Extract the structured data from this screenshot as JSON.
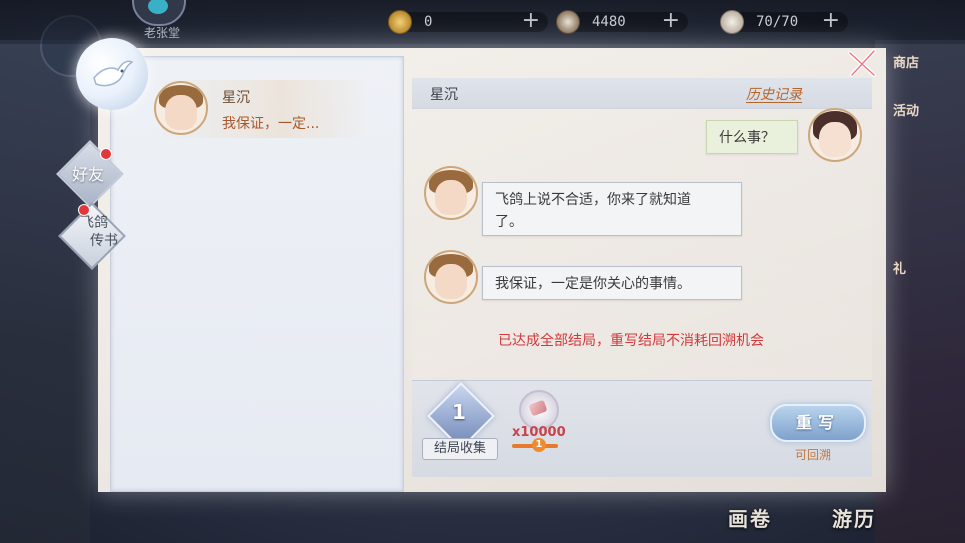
{
  "top_bar": {
    "player_label": "老张堂",
    "resources": [
      {
        "icon": "gold-coin-icon",
        "value": "0"
      },
      {
        "icon": "silver-coin-icon",
        "value": "4480"
      },
      {
        "icon": "stamina-icon",
        "value": "70/70"
      }
    ]
  },
  "background": {
    "right_labels": [
      "商店",
      "活动",
      "礼"
    ],
    "bottom_labels": [
      "画卷",
      "游历"
    ]
  },
  "sidebar": {
    "tabs": [
      {
        "label": "好友",
        "has_badge": true
      },
      {
        "label_line1": "飞鸽",
        "label_line2": "传书",
        "active": true,
        "has_badge": true
      }
    ]
  },
  "chat_list": {
    "items": [
      {
        "name": "星沉",
        "preview": "我保证，一定..."
      }
    ]
  },
  "conversation": {
    "title": "星沉",
    "history_link": "历史记录",
    "messages": [
      {
        "from": "me",
        "text": "什么事？"
      },
      {
        "from": "星沉",
        "text_line1": "飞鸽上说不合适，你来了就知道",
        "text_line2": "了。"
      },
      {
        "from": "星沉",
        "text": "我保证，一定是你关心的事情。"
      }
    ],
    "notice": "已达成全部结局，重写结局不消耗回溯机会"
  },
  "footer": {
    "ending_count": "1",
    "ending_label": "结局收集",
    "cost_amount": "x10000",
    "cost_badge": "1",
    "rewrite_button": "重写",
    "rewrite_hint": "可回溯"
  },
  "colors": {
    "accent_orange": "#b5652e",
    "notice_red": "#d3383a",
    "button_blue": "#7ea2cc"
  }
}
